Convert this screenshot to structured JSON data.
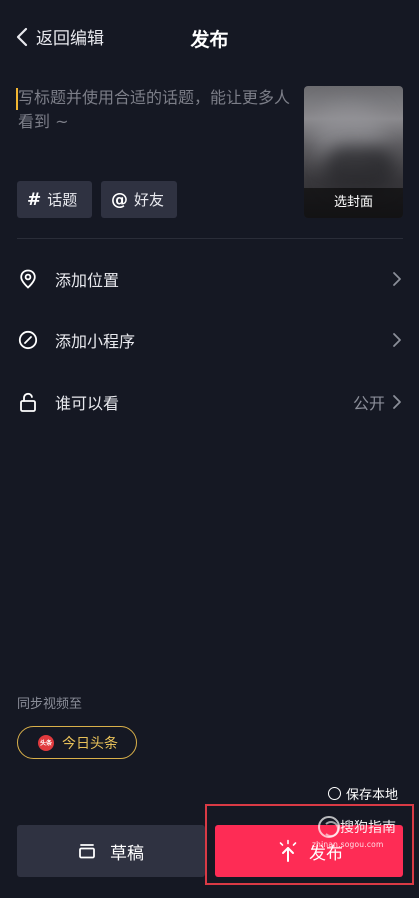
{
  "header": {
    "back_label": "返回编辑",
    "title": "发布"
  },
  "caption": {
    "placeholder": "写标题并使用合适的话题，能让更多人看到 ~",
    "value": ""
  },
  "cover": {
    "label": "选封面"
  },
  "tags": {
    "hashtag_symbol": "#",
    "hashtag_label": "话题",
    "friend_symbol": "@",
    "friend_label": "好友"
  },
  "options": {
    "location": {
      "label": "添加位置",
      "icon": "location-pin-icon"
    },
    "mini_program": {
      "label": "添加小程序",
      "icon": "link-icon"
    },
    "visibility": {
      "label": "谁可以看",
      "value": "公开",
      "icon": "unlock-icon"
    }
  },
  "sync": {
    "title": "同步视频至",
    "target_label": "今日头条",
    "target_logo_text": "头条"
  },
  "save_local": {
    "label": "保存本地",
    "checked": false
  },
  "actions": {
    "draft_label": "草稿",
    "publish_label": "发布"
  },
  "watermark": {
    "text": "搜狗指南",
    "url": "zhinan.sogou.com"
  },
  "colors": {
    "background": "#151823",
    "accent": "#fe2c55",
    "chip_border": "#d9b04a",
    "highlight": "#d93a45"
  }
}
